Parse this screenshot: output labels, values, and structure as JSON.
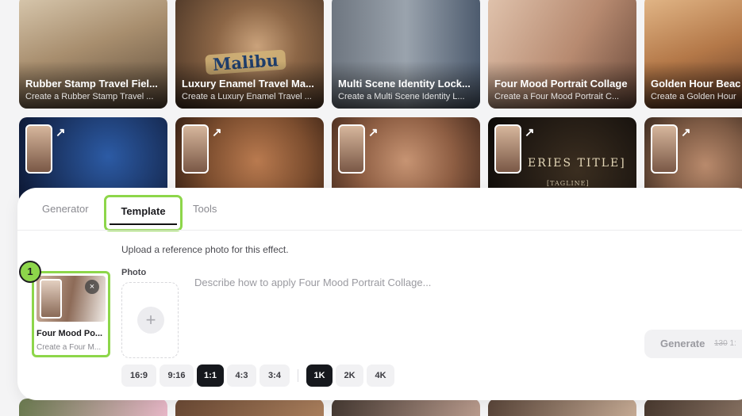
{
  "gallery_top": [
    {
      "title": "Rubber Stamp Travel Fiel...",
      "subtitle": "Create a Rubber Stamp Travel ..."
    },
    {
      "title": "Luxury Enamel Travel Ma...",
      "subtitle": "Create a Luxury Enamel Travel ...",
      "badge": "Malibu"
    },
    {
      "title": "Multi Scene Identity Lock...",
      "subtitle": "Create a Multi Scene Identity L..."
    },
    {
      "title": "Four Mood Portrait Collage",
      "subtitle": "Create a Four Mood Portrait C..."
    },
    {
      "title": "Golden Hour Beac",
      "subtitle": "Create a Golden Hour"
    }
  ],
  "gallery_mid_overlay": {
    "title": "ERIES TITLE]",
    "tagline": "[TAGLINE]"
  },
  "tabs": {
    "generator": "Generator",
    "template": "Template",
    "tools": "Tools"
  },
  "hint": "Upload a reference photo for this effect.",
  "photo_label": "Photo",
  "plus": "+",
  "prompt_placeholder": "Describe how to apply Four Mood Portrait Collage...",
  "selected_template": {
    "title": "Four Mood Po...",
    "subtitle": "Create a Four M...",
    "close": "×",
    "step": "1"
  },
  "aspect_ratios": [
    "16:9",
    "9:16",
    "1:1",
    "4:3",
    "3:4"
  ],
  "aspect_selected": "1:1",
  "resolutions": [
    "1K",
    "2K",
    "4K"
  ],
  "resolution_selected": "1K",
  "generate": {
    "label": "Generate",
    "old_cost": "130",
    "new_cost": "1:"
  },
  "arrow": "↗",
  "colors": {
    "accent": "#8dd64a",
    "selected_chip": "#16181d"
  }
}
